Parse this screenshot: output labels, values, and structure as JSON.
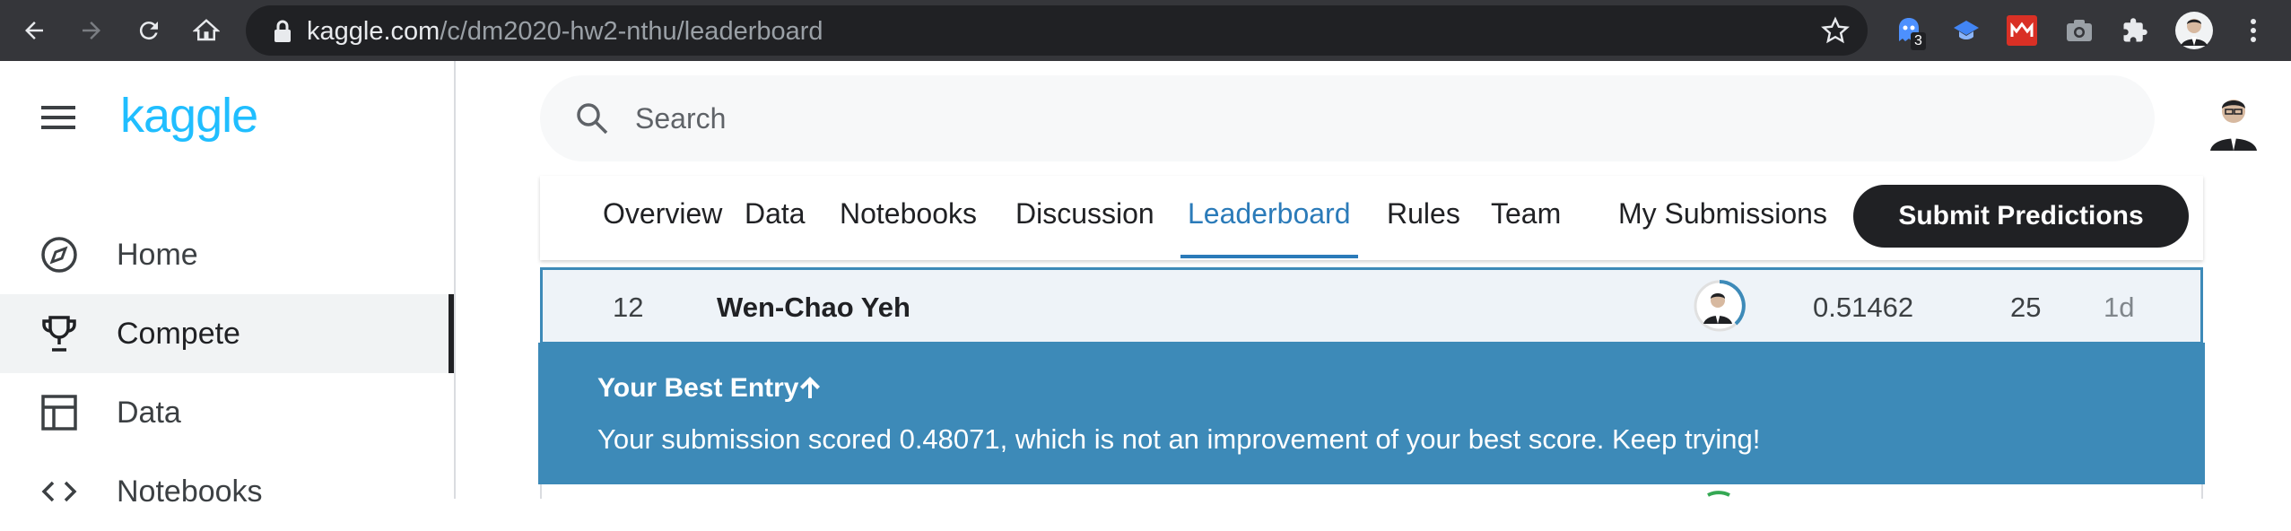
{
  "browser": {
    "url_domain": "kaggle.com",
    "url_path": "/c/dm2020-hw2-nthu/leaderboard",
    "extension_badge": "3"
  },
  "sidebar": {
    "logo": "kaggle",
    "items": [
      {
        "label": "Home",
        "icon": "compass-icon"
      },
      {
        "label": "Compete",
        "icon": "trophy-icon",
        "active": true
      },
      {
        "label": "Data",
        "icon": "table-icon"
      },
      {
        "label": "Notebooks",
        "icon": "code-icon"
      }
    ]
  },
  "search": {
    "placeholder": "Search"
  },
  "tabs": {
    "items": [
      "Overview",
      "Data",
      "Notebooks",
      "Discussion",
      "Leaderboard",
      "Rules",
      "Team",
      "My Submissions"
    ],
    "active": "Leaderboard",
    "submit_label": "Submit Predictions"
  },
  "leaderboard_row": {
    "rank": "12",
    "team": "Wen-Chao Yeh",
    "score": "0.51462",
    "entries": "25",
    "last": "1d"
  },
  "banner": {
    "title": "Your Best Entry",
    "message": "Your submission scored 0.48071, which is not an improvement of your best score. Keep trying!"
  },
  "colors": {
    "accent": "#20beff",
    "banner": "#3d8ab8",
    "button": "#202124"
  }
}
